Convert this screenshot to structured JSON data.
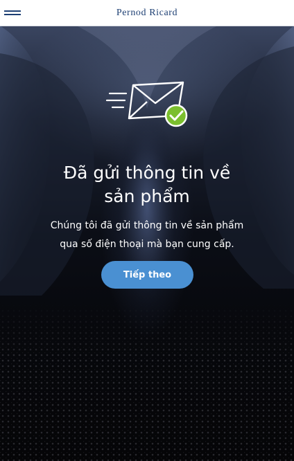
{
  "header": {
    "brand": "Pernod Ricard",
    "menu_icon": "hamburger-menu-icon"
  },
  "colors": {
    "brand_blue": "#1d3f73",
    "button_blue": "#4a90d2",
    "check_green": "#7bbf2e",
    "header_bg": "#ffffff"
  },
  "main": {
    "icon": "envelope-sent-check-icon",
    "title_line1": "Đã gửi thông tin về",
    "title_line2": "sản phẩm",
    "description_line1": "Chúng tôi đã gửi thông tin về sản phẩm",
    "description_line2": "qua số điện thoại mà bạn cung cấp.",
    "next_button": "Tiếp theo"
  }
}
